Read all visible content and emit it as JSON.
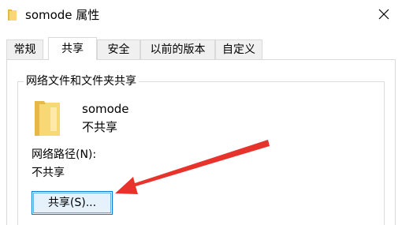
{
  "window": {
    "title": "somode 属性",
    "title_icon": "folder-icon",
    "close_icon": "close-icon"
  },
  "tabs": [
    {
      "label": "常规",
      "active": false
    },
    {
      "label": "共享",
      "active": true
    },
    {
      "label": "安全",
      "active": false
    },
    {
      "label": "以前的版本",
      "active": false
    },
    {
      "label": "自定义",
      "active": false
    }
  ],
  "sharing": {
    "group_title": "网络文件和文件夹共享",
    "folder_name": "somode",
    "folder_status": "不共享",
    "network_path_label": "网络路径(N):",
    "network_path_value": "不共享",
    "share_button_label": "共享(S)..."
  },
  "colors": {
    "folder": "#f8d775",
    "folder_dark": "#e6b84a",
    "arrow": "#e8322c",
    "button_border": "#0078d7",
    "button_fill": "#e5f1fb"
  }
}
